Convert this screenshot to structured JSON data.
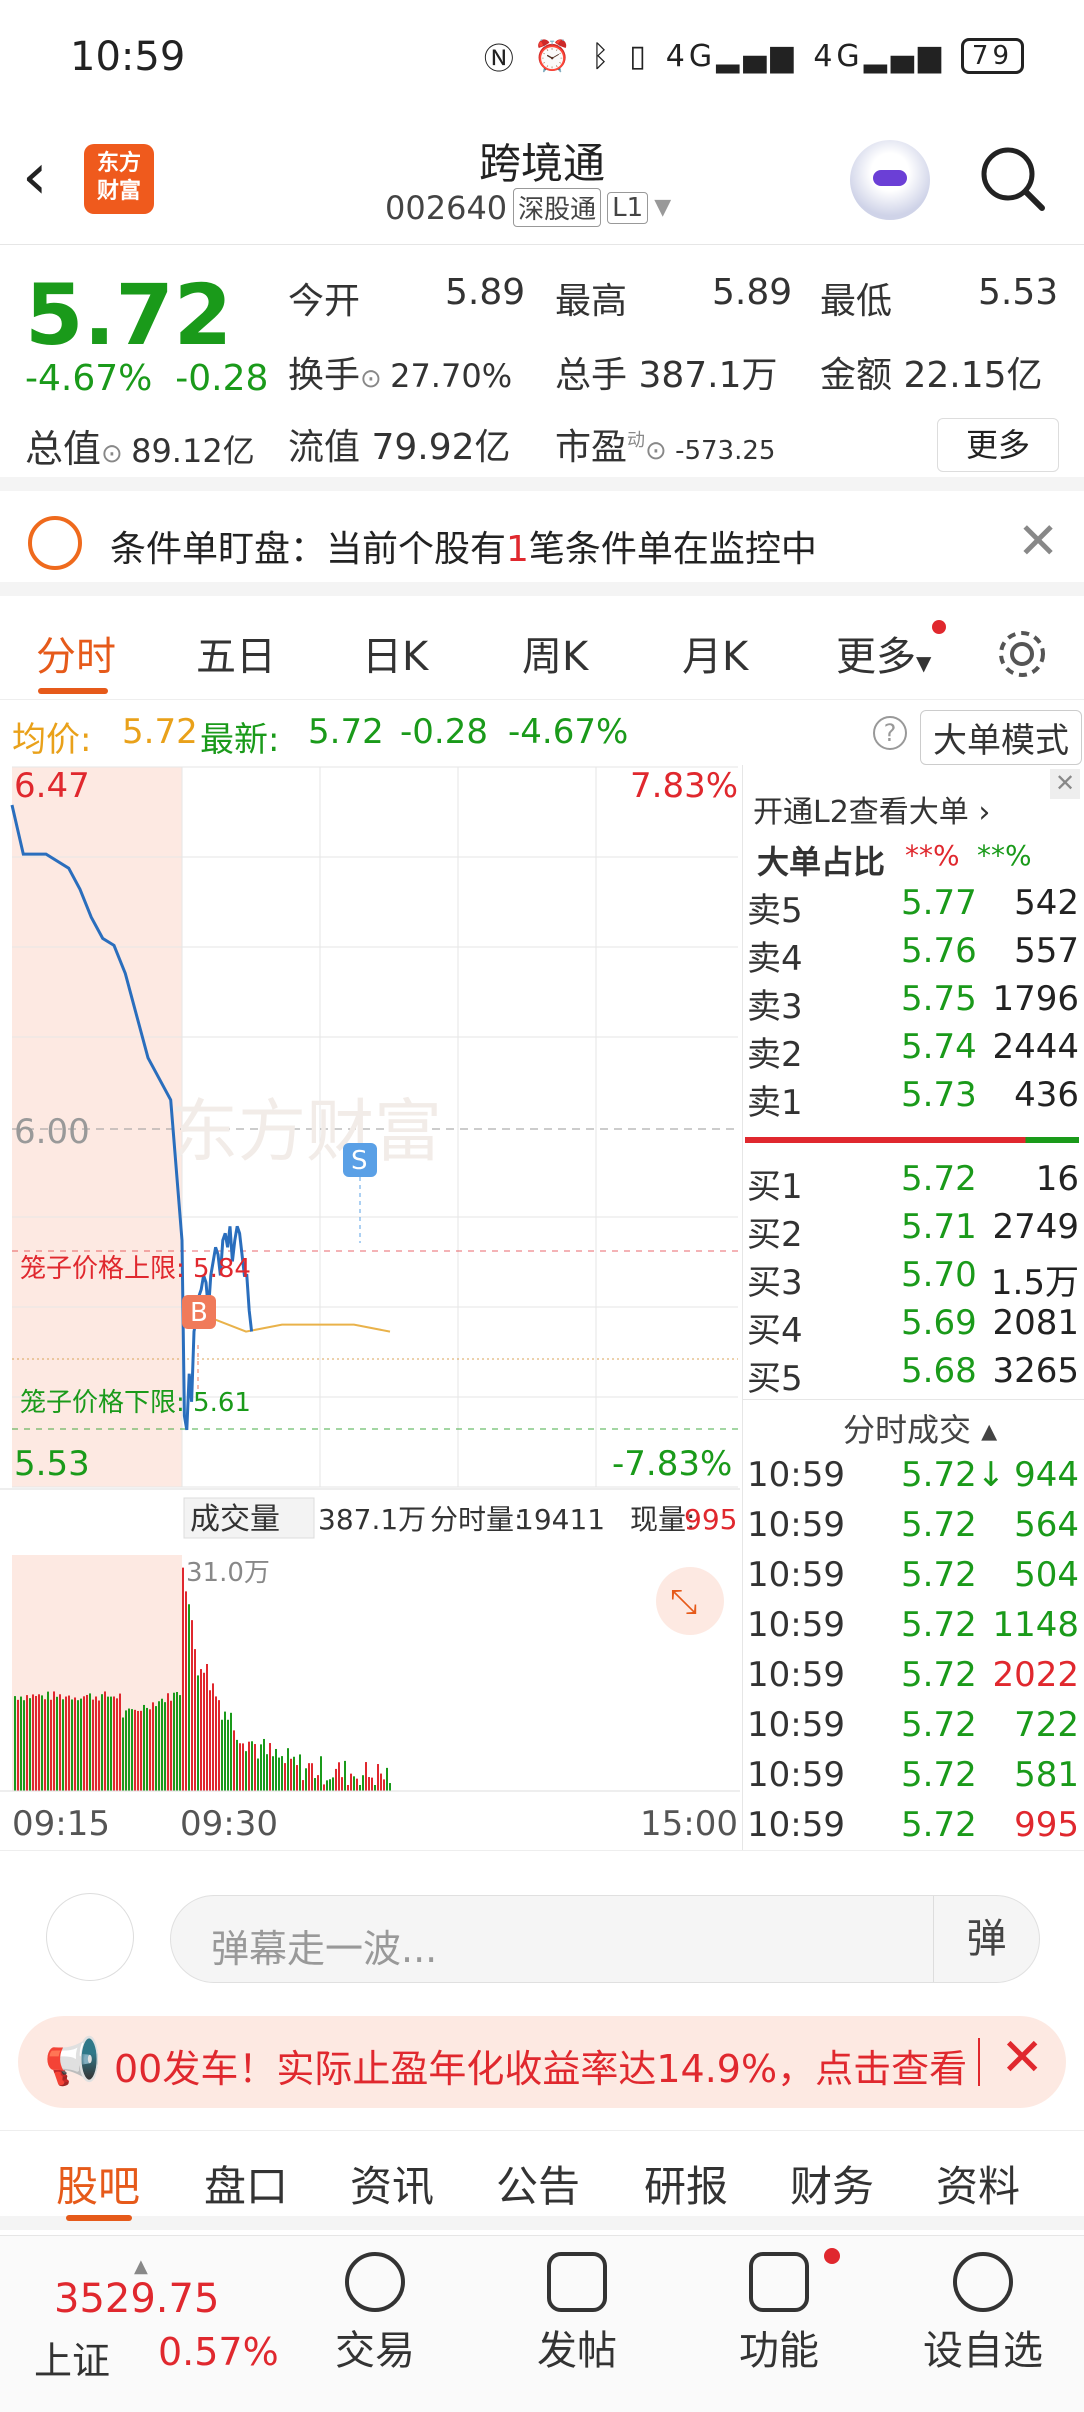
{
  "status": {
    "time": "10:59",
    "battery": "79",
    "net1": "4G",
    "net2": "4G"
  },
  "header": {
    "title": "跨境通",
    "code": "002640",
    "market_tag": "深股通",
    "level_tag": "L1",
    "logo_text": "东方\n财富"
  },
  "quote": {
    "price": "5.72",
    "change_pct": "-4.67%",
    "change_abs": "-0.28",
    "open_label": "今开",
    "open": "5.89",
    "high_label": "最高",
    "high": "5.89",
    "low_label": "最低",
    "low": "5.53",
    "turnover_label": "换手",
    "turnover": "27.70%",
    "vol_label": "总手",
    "vol": "387.1万",
    "amount_label": "金额",
    "amount": "22.15亿",
    "mktcap_label": "总值",
    "mktcap": "89.12亿",
    "float_label": "流值",
    "float_cap": "79.92亿",
    "pe_label": "市盈",
    "pe_sup": "动",
    "pe": "-573.25",
    "more": "更多"
  },
  "notice": {
    "prefix": "条件单盯盘：当前个股有",
    "count": "1",
    "suffix": "笔条件单在监控中"
  },
  "tabs": [
    "分时",
    "五日",
    "日K",
    "周K",
    "月K",
    "更多"
  ],
  "avg": {
    "avg_label": "均价:",
    "avg": "5.72",
    "last_label": "最新:",
    "last": "5.72",
    "chg": "-0.28",
    "pct": "-4.67%",
    "mode": "大单模式"
  },
  "chart": {
    "ymax_label": "6.47",
    "ymax_pct": "7.83%",
    "ymin_label": "5.53",
    "ymin_pct": "-7.83%",
    "prev_close": "6.00",
    "cage_upper": "笼子价格上限: 5.84",
    "cage_lower": "笼子价格下限: 5.61",
    "vol_label": "成交量",
    "vol_total": "387.1万",
    "vol_fen_label": "分时量:",
    "vol_fen": "19411",
    "vol_now_label": "现量:",
    "vol_now": "995",
    "vol_max": "31.0万",
    "t_start": "09:15",
    "t_mid": "09:30",
    "t_end": "15:00",
    "marker_s": "S",
    "marker_b": "B",
    "watermark": "东方财富"
  },
  "chart_data": {
    "type": "line",
    "title": "",
    "ylim": [
      5.53,
      6.47
    ],
    "prev_close": 6.0,
    "series": [
      {
        "name": "",
        "x": [
          "09:15",
          "09:16",
          "09:17",
          "09:18",
          "09:20",
          "09:21",
          "09:22",
          "09:23",
          "09:24",
          "09:25",
          "09:27",
          "09:29",
          "09:30",
          "09:31",
          "09:32",
          "09:33",
          "09:34",
          "09:35",
          "09:36",
          "09:37",
          "09:38",
          "09:39",
          "09:40",
          "09:41",
          "09:42",
          "09:43",
          "09:44",
          "09:45",
          "09:46",
          "09:47",
          "09:48",
          "09:49",
          "09:50",
          "09:51",
          "09:52",
          "09:53",
          "09:54",
          "09:55",
          "09:56",
          "09:57",
          "09:58",
          "09:59"
        ],
        "values": [
          6.47,
          6.4,
          6.4,
          6.4,
          6.38,
          6.35,
          6.31,
          6.28,
          6.27,
          6.23,
          6.11,
          6.05,
          5.85,
          5.6,
          5.58,
          5.66,
          5.62,
          5.72,
          5.74,
          5.77,
          5.78,
          5.8,
          5.79,
          5.75,
          5.8,
          5.82,
          5.84,
          5.83,
          5.8,
          5.85,
          5.86,
          5.84,
          5.87,
          5.82,
          5.85,
          5.87,
          5.86,
          5.83,
          5.8,
          5.8,
          5.75,
          5.72
        ]
      }
    ],
    "avg_line": [
      5.74,
      5.72,
      5.73,
      5.73,
      5.73,
      5.72
    ],
    "volume": {
      "label": "成交量",
      "max": "31.0万"
    }
  },
  "orderbook": {
    "open_l2": "开通L2查看大单 ›",
    "big_ratio": "大单占比",
    "ratio1": "**%",
    "ratio2": "**%",
    "asks": [
      {
        "l": "卖5",
        "p": "5.77",
        "v": "542"
      },
      {
        "l": "卖4",
        "p": "5.76",
        "v": "557"
      },
      {
        "l": "卖3",
        "p": "5.75",
        "v": "1796"
      },
      {
        "l": "卖2",
        "p": "5.74",
        "v": "2444"
      },
      {
        "l": "卖1",
        "p": "5.73",
        "v": "436"
      }
    ],
    "bids": [
      {
        "l": "买1",
        "p": "5.72",
        "v": "16"
      },
      {
        "l": "买2",
        "p": "5.71",
        "v": "2749"
      },
      {
        "l": "买3",
        "p": "5.70",
        "v": "1.5万"
      },
      {
        "l": "买4",
        "p": "5.69",
        "v": "2081"
      },
      {
        "l": "买5",
        "p": "5.68",
        "v": "3265"
      }
    ],
    "ticks_title": "分时成交 ▴",
    "ticks": [
      {
        "t": "10:59",
        "p": "5.72↓",
        "v": "944",
        "c": "g"
      },
      {
        "t": "10:59",
        "p": "5.72",
        "v": "564",
        "c": "g"
      },
      {
        "t": "10:59",
        "p": "5.72",
        "v": "504",
        "c": "g"
      },
      {
        "t": "10:59",
        "p": "5.72",
        "v": "1148",
        "c": "g"
      },
      {
        "t": "10:59",
        "p": "5.72",
        "v": "2022",
        "c": "r"
      },
      {
        "t": "10:59",
        "p": "5.72",
        "v": "722",
        "c": "g"
      },
      {
        "t": "10:59",
        "p": "5.72",
        "v": "581",
        "c": "g"
      },
      {
        "t": "10:59",
        "p": "5.72",
        "v": "995",
        "c": "r"
      }
    ]
  },
  "comment": {
    "placeholder": "弹幕走一波...",
    "btn": "弹"
  },
  "ad": {
    "text": "00发车！实际止盈年化收益率达14.9%，点击查看"
  },
  "subtabs": [
    "股吧",
    "盘口",
    "资讯",
    "公告",
    "研报",
    "财务",
    "资料"
  ],
  "bottom": {
    "index_value": "3529.75",
    "index_name": "上证",
    "index_pct": "0.57%",
    "trade": "交易",
    "post": "发帖",
    "func": "功能",
    "watch": "设自选"
  },
  "colors": {
    "accent": "#e65a1a",
    "up": "#e0282e",
    "down": "#1a9a1a",
    "line": "#2a6ebd"
  }
}
